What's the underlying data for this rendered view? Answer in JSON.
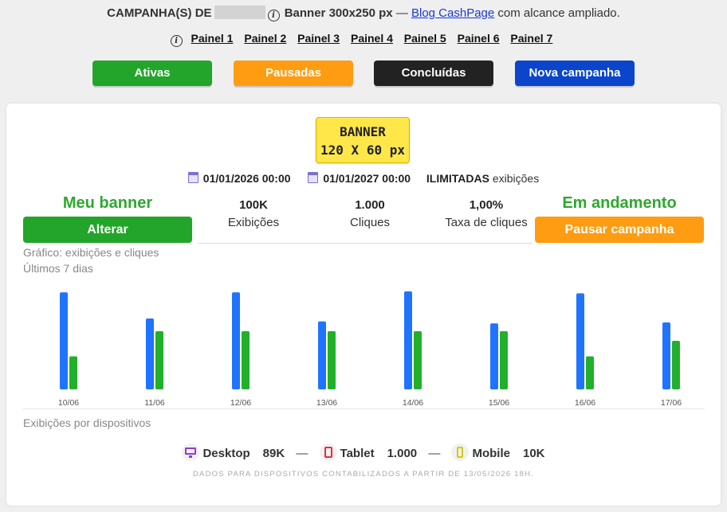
{
  "header": {
    "prefix": "CAMPANHA(S) DE",
    "banner_label": "Banner 300x250 px",
    "dash": "—",
    "site_link": "Blog CashPage",
    "suffix": "com alcance ampliado."
  },
  "panels": [
    "Painel 1",
    "Painel 2",
    "Painel 3",
    "Painel 4",
    "Painel 5",
    "Painel 6",
    "Painel 7"
  ],
  "filters": [
    {
      "label": "Ativas",
      "color": "#22a52a"
    },
    {
      "label": "Pausadas",
      "color": "#ff9c12"
    },
    {
      "label": "Concluídas",
      "color": "#222222"
    },
    {
      "label": "Nova campanha",
      "color": "#0a45cc"
    }
  ],
  "campaign": {
    "banner_line1": "BANNER",
    "banner_line2": "120 X 60 px",
    "start": "01/01/2026 00:00",
    "end": "01/01/2027 00:00",
    "limit_bold": "ILIMITADAS",
    "limit_text": "exibições",
    "left_title": "Meu banner",
    "left_button": "Alterar",
    "right_title": "Em andamento",
    "right_button": "Pausar campanha",
    "stats": [
      {
        "value": "100K",
        "label": "Exibições"
      },
      {
        "value": "1.000",
        "label": "Cliques"
      },
      {
        "value": "1,00%",
        "label": "Taxa de cliques"
      }
    ]
  },
  "chart_caption": "Gráfico: exibições e cliques",
  "chart_period": "Últimos 7 dias",
  "chart_data": {
    "type": "bar",
    "categories": [
      "10/06",
      "11/06",
      "12/06",
      "13/06",
      "14/06",
      "15/06",
      "16/06",
      "17/06"
    ],
    "series": [
      {
        "values": [
          100,
          73,
          100,
          70,
          101,
          68,
          99,
          69
        ],
        "color": "#1f74ff"
      },
      {
        "values": [
          34,
          60,
          60,
          60,
          60,
          60,
          34,
          50
        ],
        "color": "#22b02a"
      }
    ],
    "ylim": [
      0,
      105
    ],
    "grid": false
  },
  "devices_caption": "Exibições por dispositivos",
  "devices": [
    {
      "name": "Desktop",
      "value": "89K",
      "icon": "desktop-icon"
    },
    {
      "name": "Tablet",
      "value": "1.000",
      "icon": "tablet-icon"
    },
    {
      "name": "Mobile",
      "value": "10K",
      "icon": "mobile-icon"
    }
  ],
  "devices_sep": "—",
  "footnote": "DADOS PARA DISPOSITIVOS CONTABILIZADOS A PARTIR DE 13/05/2026 18H."
}
